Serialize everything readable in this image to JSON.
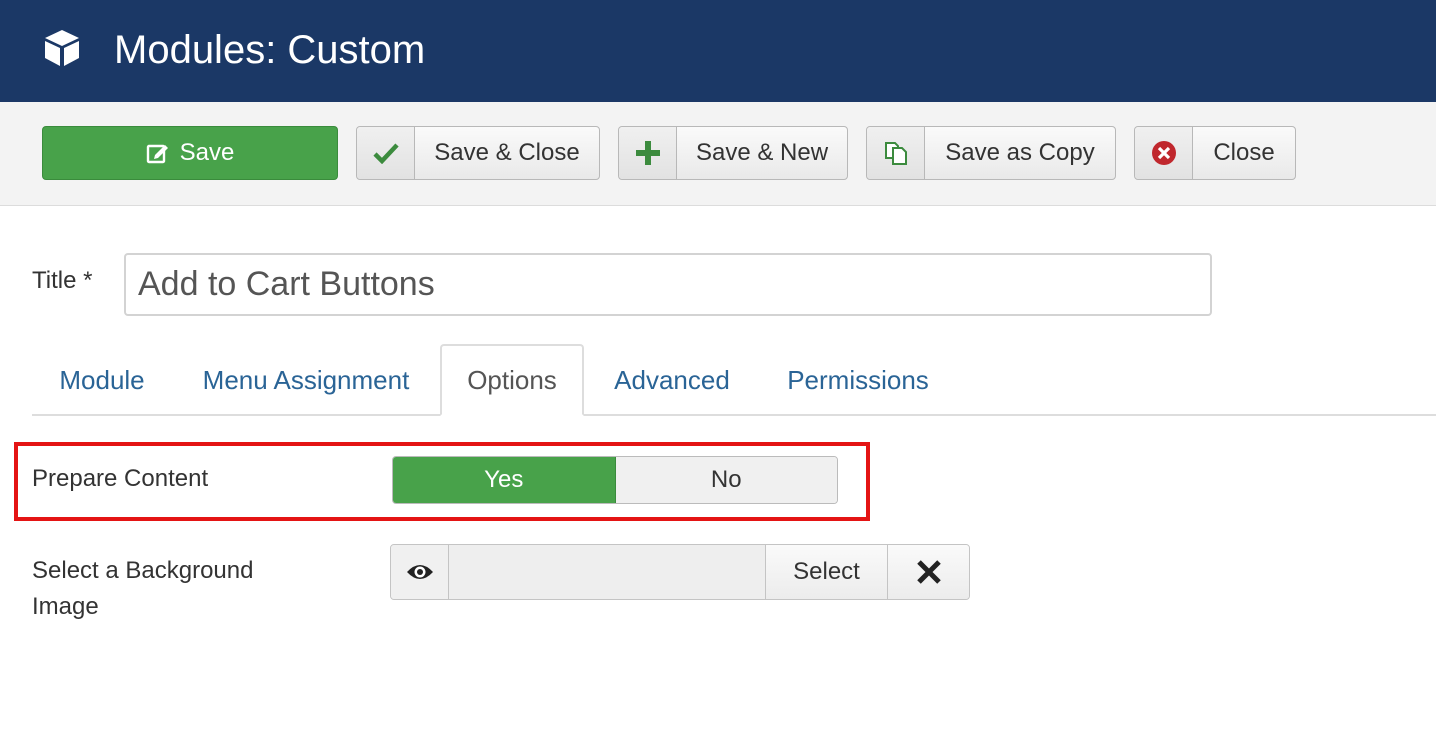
{
  "header": {
    "title": "Modules: Custom",
    "icon": "cube-icon"
  },
  "toolbar": {
    "save_label": "Save",
    "save_close_label": "Save & Close",
    "save_new_label": "Save & New",
    "save_copy_label": "Save as Copy",
    "close_label": "Close"
  },
  "form": {
    "title_label": "Title *",
    "title_value": "Add to Cart Buttons"
  },
  "tabs": [
    {
      "label": "Module"
    },
    {
      "label": "Menu Assignment"
    },
    {
      "label": "Options"
    },
    {
      "label": "Advanced"
    },
    {
      "label": "Permissions"
    }
  ],
  "active_tab": "Options",
  "options": {
    "prepare_content_label": "Prepare Content",
    "yes_label": "Yes",
    "no_label": "No",
    "selected": "Yes",
    "background_label_line1": "Select a Background",
    "background_label_line2": "Image",
    "select_label": "Select",
    "background_value": ""
  },
  "colors": {
    "header_bg": "#1b3866",
    "save_green": "#48a24a",
    "tab_link": "#2a6496",
    "highlight_red": "#e41414"
  }
}
